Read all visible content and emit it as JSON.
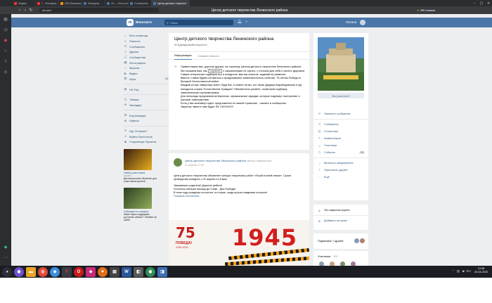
{
  "browser": {
    "tabs": [
      {
        "label": "Яндекс",
        "color": "#f33",
        "active": false
      },
      {
        "label": "7 - Фасадник — Яндекс",
        "color": "#f33",
        "active": false
      },
      {
        "label": "(59) Вацапыши — Поиск Ват",
        "color": "#f90",
        "active": false
      },
      {
        "label": "Фасадник",
        "color": "#4a76a8",
        "active": false
      },
      {
        "label": "VK — Мои результаты",
        "color": "#4a76a8",
        "active": false
      },
      {
        "label": "Сообщения",
        "color": "#4a76a8",
        "active": false
      },
      {
        "label": "Центр детского творчест",
        "color": "#4a76a8",
        "active": true
      }
    ],
    "url": "vk.com",
    "page_title": "Центр детского творчества Ленинского района",
    "extension_label": "59К отзывов"
  },
  "vk": {
    "brand": "ВКонтакте",
    "search_placeholder": "Поиск",
    "user_name": "Оксана"
  },
  "leftnav": [
    {
      "icon": "⌂",
      "icon_name": "home-icon",
      "label": "Моя страница",
      "count": ""
    },
    {
      "icon": "≡",
      "icon_name": "news-icon",
      "label": "Новости",
      "count": ""
    },
    {
      "icon": "✉",
      "icon_name": "messages-icon",
      "label": "Сообщения",
      "count": ""
    },
    {
      "icon": "☺",
      "icon_name": "friends-icon",
      "label": "Друзья",
      "count": ""
    },
    {
      "icon": "☷",
      "icon_name": "communities-icon",
      "label": "Сообщества",
      "count": ""
    },
    {
      "icon": "▣",
      "icon_name": "photos-icon",
      "label": "Фотографии",
      "count": ""
    },
    {
      "icon": "♪",
      "icon_name": "music-icon",
      "label": "Музыка",
      "count": ""
    },
    {
      "icon": "▶",
      "icon_name": "video-icon",
      "label": "Видео",
      "count": ""
    },
    {
      "icon": "✪",
      "icon_name": "games-icon",
      "label": "Игры",
      "count": "12"
    }
  ],
  "leftnav2": [
    {
      "icon": "◉",
      "icon_name": "vkpay-icon",
      "label": "VK Pay"
    }
  ],
  "leftnav3": [
    {
      "icon": "☰",
      "icon_name": "goods-icon",
      "label": "Товары"
    },
    {
      "icon": "★",
      "icon_name": "bookmarks-icon",
      "label": "Закладки"
    }
  ],
  "leftnav4": [
    {
      "icon": "✿",
      "icon_name": "coronavirus-icon",
      "label": "Коронавирус"
    },
    {
      "icon": "◈",
      "icon_name": "afisha-icon",
      "label": "Афиша"
    }
  ],
  "leftnav5": [
    {
      "icon": "✈",
      "icon_name": "app-icon",
      "label": "Где Отличие?"
    },
    {
      "icon": "⚔",
      "icon_name": "app-icon",
      "label": "Война Престолов"
    },
    {
      "icon": "◆",
      "icon_name": "app-icon",
      "label": "Сокровища Пиратов"
    }
  ],
  "promos": [
    {
      "title": "Набор участников",
      "sub": "Группа",
      "desc": "Дистанционное обучение для участников проекта",
      "color1": "#3a1d0e",
      "color2": "#e8b020"
    },
    {
      "title": "Субсидии по кредиту",
      "sub": "",
      "desc": "Какие меры поддержки доступны сейчас? Узнайте на сайте",
      "color1": "#2c3e20",
      "color2": "#8fae5a"
    }
  ],
  "group": {
    "title": "Центр детского творчества Ленинского района",
    "tag": "#СидимДомаВсеКручено",
    "tabs": [
      "Информация",
      "Свежие новости"
    ],
    "info_lines": [
      "Приветствуем вас, дорогие друзья, на странице Центра детского творчества Ленинского района!",
      "Мы покажем вам, как",
      "Сохранить",
      "с самоизоляции не скучно, с пользой для себя и своего здоровья!",
      "Самые интересные подборки игр и конкурсов, мастер-классов, заданий на развитие.",
      "Вместе с вами будем готовиться к празднованию знаменательного события, 75-летию Победы в Великой Отечественной войне.",
      "Каждый из вас наверняка знает Леди Баг, а знаете ли вы, кто такая Дюдюка Барабидовская и где находится страна Тилли-Милли-Трямдия? Обязательно узнаете, посмотрев подборку замечательных мультфильмов.",
      "Для непоседы предлагаем интересные, музыкальные зарядки, которые поднимут настроение и улучшат самочувствие.",
      "Если у вас возникнут идеи, предложения по нашей страничке - пишите в сообщения.",
      "Уверены, вместе нам будет НЕ СКУЧНО!!!"
    ]
  },
  "post": {
    "author": "Центр детского творчества Ленинского района",
    "author_suffix": "запись закреплена",
    "date": "21 апреля 17:32",
    "text1": "Центр детского творчества объявляет конкурс творческих работ «Герой в моей семье». Сроки проведения конкурса с 22 апреля по 8 мая.",
    "text2": "Уважаемые родители! Дорогие ребята!",
    "text3": "Осталось меньше месяца до 9 мая - Дня Победы!",
    "text4": "В этом году праздник состоится, но позже, когда угроза эпидемии отступит!",
    "more": "Показать полностью...",
    "image": {
      "badge": "75",
      "pobeda": "ПОБЕДА!",
      "years": "1945–2020",
      "year": "1945"
    }
  },
  "right": {
    "photo_button": "Вы участник ▾",
    "actions": [
      {
        "icon": "✉",
        "icon_name": "write-message-icon",
        "label": "Написать сообщение",
        "count": ""
      }
    ],
    "sections": [
      {
        "icon": "✉",
        "icon_name": "messages-icon",
        "label": "Сообщения",
        "count": ""
      },
      {
        "icon": "▥",
        "icon_name": "stats-icon",
        "label": "Статистика",
        "count": ""
      },
      {
        "icon": "✎",
        "icon_name": "comments-icon",
        "label": "Комментарии",
        "count": ""
      },
      {
        "icon": "☺",
        "icon_name": "members-icon",
        "label": "Участники",
        "count": ""
      },
      {
        "icon": "◷",
        "icon_name": "events-icon",
        "label": "События",
        "count": "99"
      }
    ],
    "extra": [
      {
        "icon": "♫",
        "icon_name": "notifications-icon",
        "label": "Включить уведомления",
        "count": ""
      },
      {
        "icon": "⇪",
        "icon_name": "share-icon",
        "label": "Пригласить друзей",
        "count": ""
      },
      {
        "icon": "⋯",
        "icon_name": "more-icon",
        "label": "Ещё",
        "count": ""
      }
    ],
    "closed_group": "Это закрытая группа",
    "add_story": "Добавить историю",
    "subscriptions": "Подписаны 7 друзей",
    "members_label": "Участники",
    "members_count": "139"
  },
  "taskbar": {
    "time": "12:48",
    "date": "20.04.2020",
    "lang": "RU"
  }
}
